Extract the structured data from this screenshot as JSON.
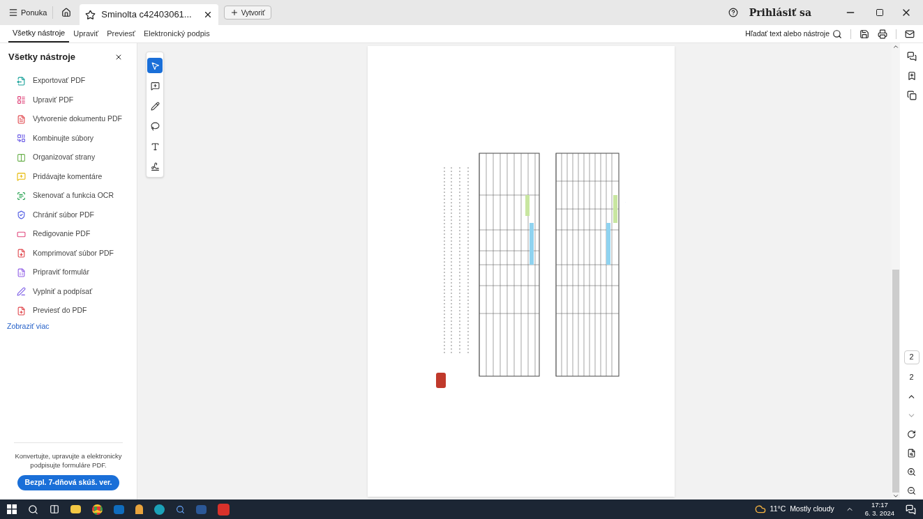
{
  "title_bar": {
    "menu": "Ponuka",
    "tabs": [
      {
        "label": "Sminolta c42403061...",
        "selected": true
      }
    ],
    "new_button": "Vytvoriť",
    "sign_in": "Prihlásiť sa"
  },
  "toolbar": {
    "tabs": [
      {
        "label": "Všetky nástroje",
        "selected": true
      },
      {
        "label": "Upraviť",
        "selected": false
      },
      {
        "label": "Previesť",
        "selected": false
      },
      {
        "label": "Elektronický podpis",
        "selected": false
      }
    ],
    "search": "Hľadať text alebo nástroje"
  },
  "panel": {
    "title": "Všetky nástroje",
    "items": [
      {
        "kind": "export",
        "label": "Exportovať PDF"
      },
      {
        "kind": "edit",
        "label": "Upraviť PDF"
      },
      {
        "kind": "create",
        "label": "Vytvorenie dokumentu PDF"
      },
      {
        "kind": "combine",
        "label": "Kombinujte súbory"
      },
      {
        "kind": "organize",
        "label": "Organizovať strany"
      },
      {
        "kind": "comment",
        "label": "Pridávajte komentáre"
      },
      {
        "kind": "scan",
        "label": "Skenovať a funkcia OCR"
      },
      {
        "kind": "protect",
        "label": "Chrániť súbor PDF"
      },
      {
        "kind": "redact",
        "label": "Redigovanie PDF"
      },
      {
        "kind": "compress",
        "label": "Komprimovať súbor PDF"
      },
      {
        "kind": "form",
        "label": "Pripraviť formulár"
      },
      {
        "kind": "sign",
        "label": "Vyplniť a podpísať"
      },
      {
        "kind": "convert",
        "label": "Previesť do PDF"
      }
    ],
    "more": "Zobraziť viac",
    "promo": "Konvertujte, upravujte a elektronicky podpisujte formuláre PDF.",
    "trial": "Bezpl. 7-dňová skúš. ver."
  },
  "palette": [
    {
      "kind": "select",
      "selected": true
    },
    {
      "kind": "comment",
      "selected": false
    },
    {
      "kind": "pen",
      "selected": false
    },
    {
      "kind": "lasso",
      "selected": false
    },
    {
      "kind": "text",
      "selected": false
    },
    {
      "kind": "sign",
      "selected": false
    }
  ],
  "page_nav": {
    "current": "2",
    "total": "2"
  },
  "taskbar": {
    "weather": "11°C  Mostly cloudy",
    "time": "17:17",
    "date": "6. 3. 2024"
  }
}
